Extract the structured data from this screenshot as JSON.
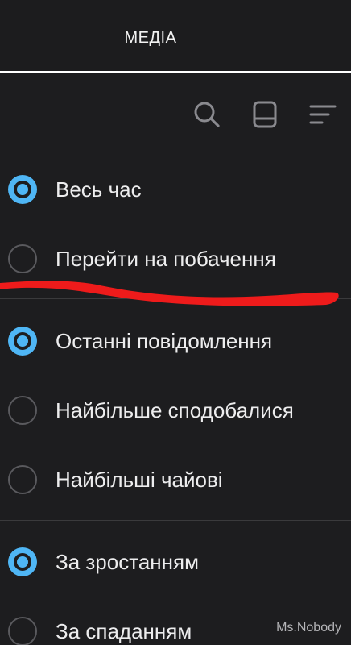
{
  "header": {
    "tab_title": "МЕДІА"
  },
  "toolbar": {
    "icons": [
      "search-icon",
      "book-icon",
      "sort-lines-icon"
    ]
  },
  "options": [
    {
      "label": "Весь час",
      "checked": true
    },
    {
      "label": "Перейти на побачення",
      "checked": false
    },
    {
      "label": "Останні повідомлення",
      "checked": true
    },
    {
      "label": "Найбільше сподобалися",
      "checked": false
    },
    {
      "label": "Найбільші чайові",
      "checked": false
    },
    {
      "label": "За зростанням",
      "checked": true
    },
    {
      "label": "За спаданням",
      "checked": false
    }
  ],
  "colors": {
    "background": "#1d1d1f",
    "accent": "#4fb6f5",
    "annotation": "#ee1b1b"
  },
  "watermark": "Ms.Nobody"
}
